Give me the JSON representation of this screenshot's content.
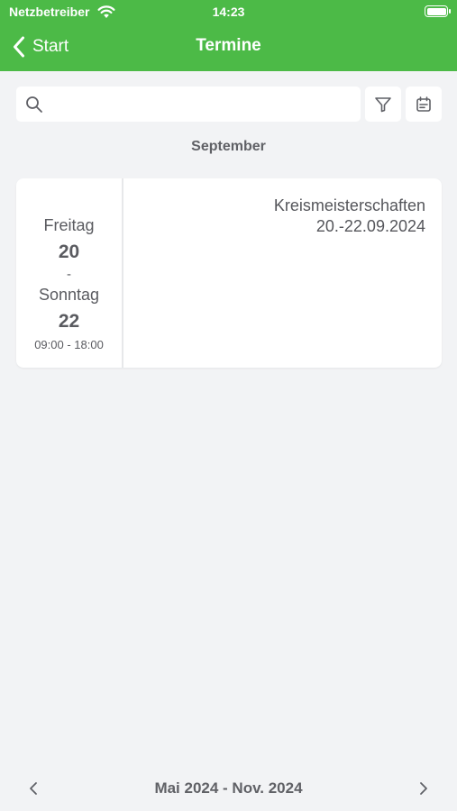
{
  "status_bar": {
    "carrier": "Netzbetreiber",
    "time": "14:23",
    "wifi_icon": "wifi-icon",
    "battery_icon": "battery-icon"
  },
  "nav": {
    "back_label": "Start",
    "title": "Termine",
    "bar_color": "#4cba47"
  },
  "search": {
    "placeholder": "",
    "value": "",
    "filter_icon": "filter-icon",
    "calendar_icon": "calendar-icon"
  },
  "month": "September",
  "events": [
    {
      "start_day": "Freitag",
      "start_date": "20",
      "separator": "-",
      "end_day": "Sonntag",
      "end_date": "22",
      "time": "09:00 - 18:00",
      "title": "Kreismeisterschaften",
      "date_range": "20.-22.09.2024"
    }
  ],
  "pager": {
    "range": "Mai 2024 - Nov. 2024"
  }
}
